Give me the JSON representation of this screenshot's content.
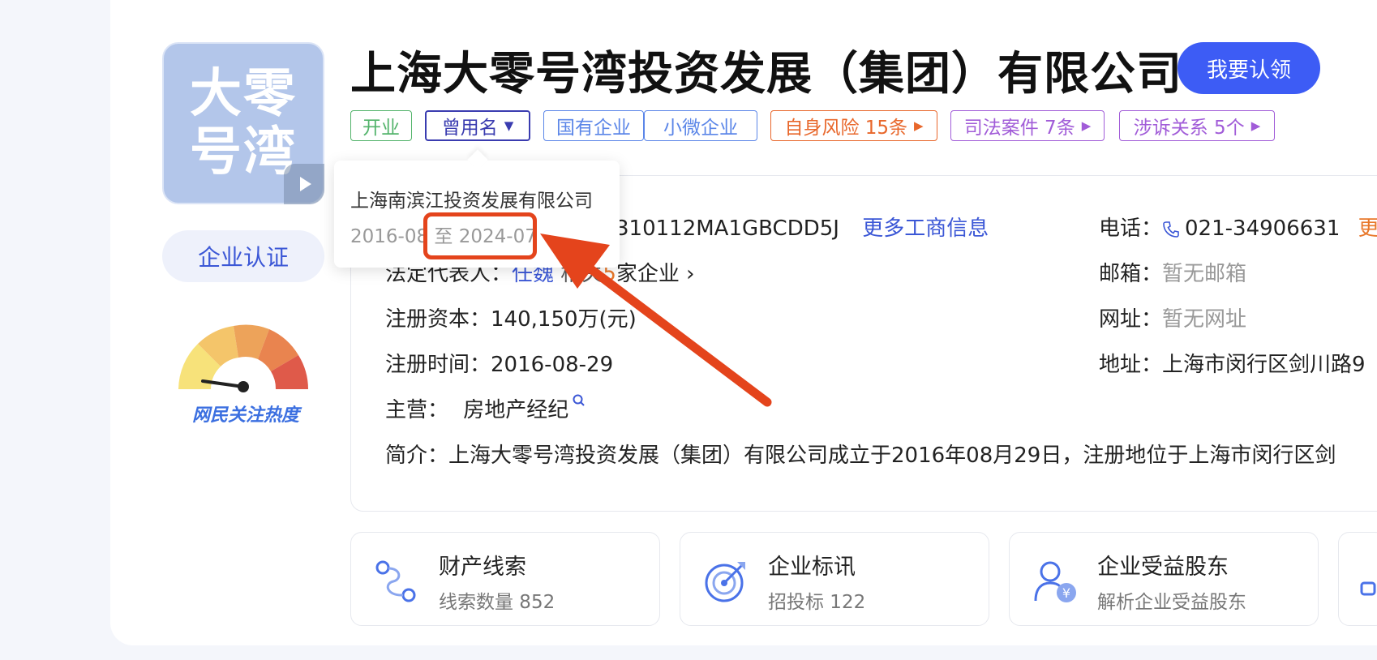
{
  "company": {
    "logo_text": "大零号湾",
    "name": "上海大零号湾投资发展（集团）有限公司",
    "claim_button": "我要认领",
    "certify_button": "企业认证",
    "heat_label": "网民关注热度"
  },
  "tags": [
    {
      "label": "开业",
      "color": "#52b36a"
    },
    {
      "label": "曾用名",
      "color": "#3a3cb0",
      "dropdown": true
    },
    {
      "label": "国有企业",
      "color": "#5b86e8"
    },
    {
      "label": "小微企业",
      "color": "#5b86e8"
    },
    {
      "label": "自身风险 15条",
      "color": "#e8672b"
    },
    {
      "label": "司法案件 7条",
      "color": "#a15cd8"
    },
    {
      "label": "涉诉关系 5个",
      "color": "#a15cd8"
    }
  ],
  "former_name_popup": {
    "name": "上海南滨江投资发展有限公司",
    "period_start": "2016-08",
    "period_sep": "至",
    "period_end": "2024-07"
  },
  "info": {
    "credit_code": "310112MA1GBCDD5J",
    "more_link": "更多工商信息",
    "phone_label": "电话：",
    "phone": "021-34906631",
    "phone_more": "更",
    "legal_label": "法定代表人：",
    "legal_name": "任魏",
    "legal_related_prefix": "相关",
    "legal_related_count": "5",
    "legal_related_suffix": "家企业",
    "email_label": "邮箱：",
    "email": "暂无邮箱",
    "capital_label": "注册资本：",
    "capital": "140,150万(元)",
    "website_label": "网址：",
    "website": "暂无网址",
    "reg_time_label": "注册时间：",
    "reg_time": "2016-08-29",
    "address_label": "地址：",
    "address": "上海市闵行区剑川路9",
    "business_label": "主营：",
    "business": "房地产经纪",
    "intro_label": "简介：",
    "intro": "上海大零号湾投资发展（集团）有限公司成立于2016年08月29日，注册地位于上海市闵行区剑"
  },
  "feature_cards": [
    {
      "title": "财产线索",
      "sub": "线索数量 852",
      "icon": "clue-icon"
    },
    {
      "title": "企业标讯",
      "sub": "招投标 122",
      "icon": "target-icon"
    },
    {
      "title": "企业受益股东",
      "sub": "解析企业受益股东",
      "icon": "shareholder-icon"
    }
  ],
  "colors": {
    "accent": "#3d5cf5",
    "annotation": "#e4441c"
  }
}
